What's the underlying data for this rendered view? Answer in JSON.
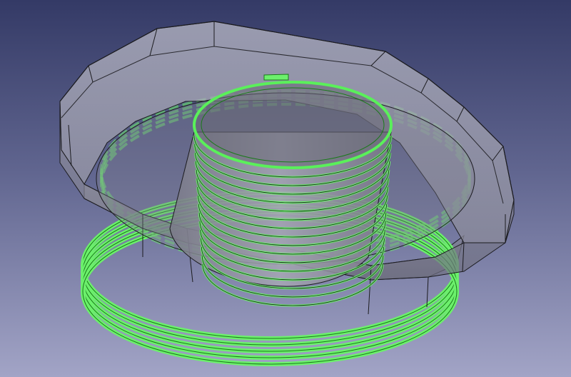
{
  "viewport": {
    "background_top": "#343a66",
    "background_bottom": "#a2a4c6"
  },
  "model": {
    "nut_body_color": "#8e8e9c",
    "nut_edge_color": "#1b1b1f",
    "selected_thread_color": "#6cf06c",
    "selected_thread_edge": "#1a7a1a",
    "hex_faces": 8,
    "outer_thread_turns": 5,
    "inner_thread_turns": 16
  }
}
